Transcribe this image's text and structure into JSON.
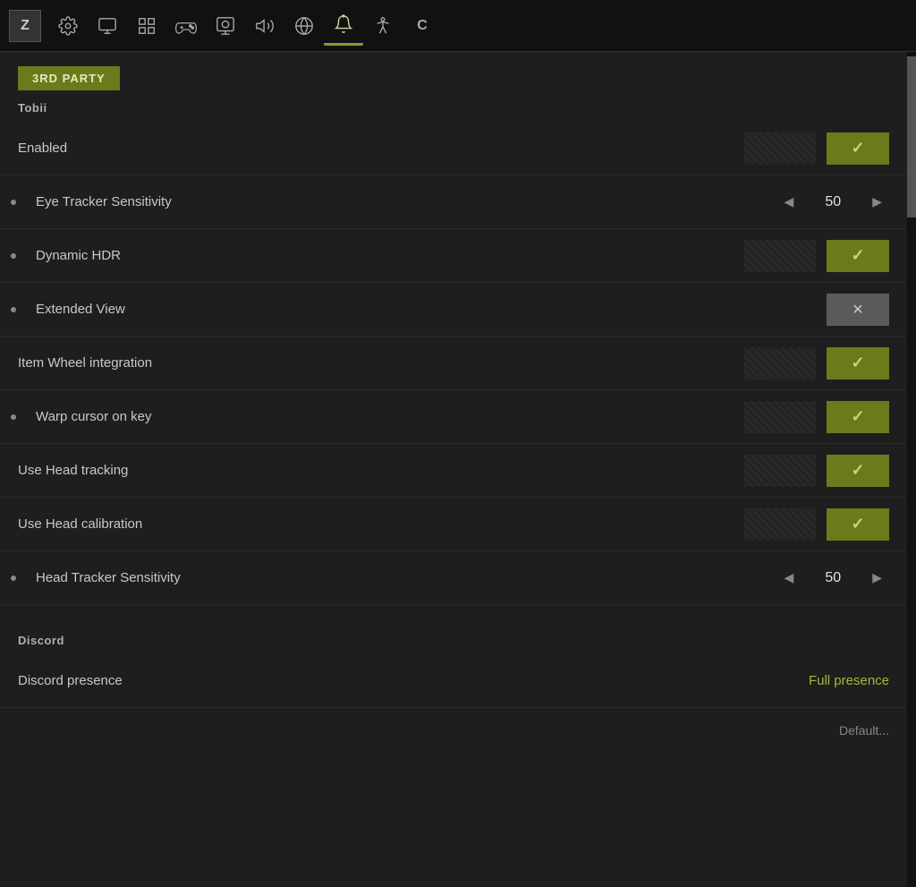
{
  "nav": {
    "z_label": "Z",
    "icons": [
      {
        "name": "gear-icon",
        "symbol": "⚙",
        "active": false
      },
      {
        "name": "display-icon",
        "symbol": "▦",
        "active": false
      },
      {
        "name": "grid-icon",
        "symbol": "⊞",
        "active": false
      },
      {
        "name": "gamepad-icon",
        "symbol": "⊡",
        "active": false
      },
      {
        "name": "monitor-icon",
        "symbol": "⬜",
        "active": false
      },
      {
        "name": "speaker-icon",
        "symbol": "◈",
        "active": false
      },
      {
        "name": "globe-icon",
        "symbol": "◎",
        "active": false
      },
      {
        "name": "bell-icon",
        "symbol": "◉",
        "active": true
      },
      {
        "name": "accessibility-icon",
        "symbol": "♿",
        "active": false
      },
      {
        "name": "c-icon",
        "symbol": "C",
        "active": false
      }
    ]
  },
  "sections": {
    "party_label": "3rd PARTY",
    "tobii": {
      "header": "Tobii",
      "rows": [
        {
          "id": "enabled",
          "label": "Enabled",
          "control_type": "toggle",
          "value": true,
          "indented": false
        },
        {
          "id": "eye_tracker_sensitivity",
          "label": "Eye Tracker Sensitivity",
          "control_type": "stepper",
          "value": "50",
          "indented": true
        },
        {
          "id": "dynamic_hdr",
          "label": "Dynamic HDR",
          "control_type": "toggle",
          "value": true,
          "indented": true
        },
        {
          "id": "extended_view",
          "label": "Extended View",
          "control_type": "toggle",
          "value": false,
          "indented": true
        },
        {
          "id": "item_wheel_integration",
          "label": "Item Wheel integration",
          "control_type": "toggle",
          "value": true,
          "indented": false
        },
        {
          "id": "warp_cursor_on_key",
          "label": "Warp cursor on key",
          "control_type": "toggle",
          "value": true,
          "indented": true
        },
        {
          "id": "use_head_tracking",
          "label": "Use Head tracking",
          "control_type": "toggle",
          "value": true,
          "indented": false
        },
        {
          "id": "use_head_calibration",
          "label": "Use Head calibration",
          "control_type": "toggle",
          "value": true,
          "indented": false
        },
        {
          "id": "head_tracker_sensitivity",
          "label": "Head Tracker Sensitivity",
          "control_type": "stepper",
          "value": "50",
          "indented": true
        }
      ]
    },
    "discord": {
      "header": "Discord",
      "rows": [
        {
          "id": "discord_presence",
          "label": "Discord presence",
          "control_type": "value_display",
          "value": "Full presence",
          "indented": false
        },
        {
          "id": "discord_partial",
          "label": "",
          "control_type": "partial",
          "value": "Default...",
          "indented": false
        }
      ]
    }
  }
}
